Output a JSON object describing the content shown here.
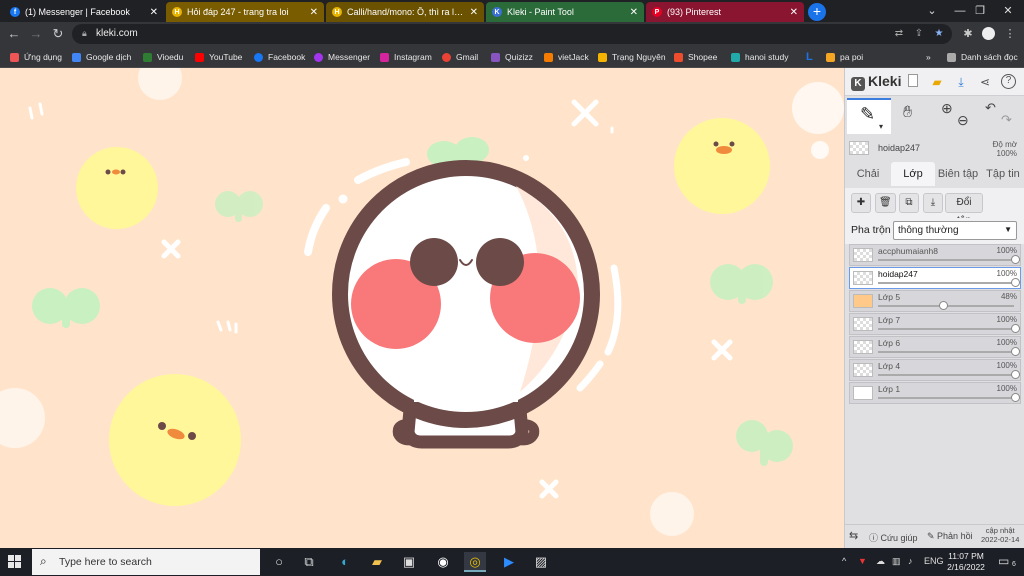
{
  "browser": {
    "tabs": [
      {
        "title": "(1) Messenger | Facebook",
        "icon": "facebook-icon",
        "color": "#1877f2",
        "letter": "f"
      },
      {
        "title": "Hỏi đáp 247 - trang tra loi",
        "icon": "hoidap-icon",
        "color": "#e8b400",
        "letter": "H"
      },
      {
        "title": "Calli/hand/mono: Ồ, thì ra là thế",
        "icon": "hoidap-icon",
        "color": "#e8b400",
        "letter": "H"
      },
      {
        "title": "Kleki - Paint Tool",
        "icon": "kleki-icon",
        "color": "#3a6fd8",
        "letter": "K"
      },
      {
        "title": "(93) Pinterest",
        "icon": "pinterest-icon",
        "color": "#e60023",
        "letter": "P"
      }
    ],
    "url": "kleki.com",
    "bookmarks": [
      {
        "label": "Ứng dụng",
        "color": "#e55"
      },
      {
        "label": "Google dịch",
        "color": "#4285f4"
      },
      {
        "label": "Vioedu",
        "color": "#2e7d32"
      },
      {
        "label": "YouTube",
        "color": "#ff0000"
      },
      {
        "label": "Facebook",
        "color": "#1877f2"
      },
      {
        "label": "Messenger",
        "color": "#a335ee"
      },
      {
        "label": "Instagram",
        "color": "#d6249f"
      },
      {
        "label": "Gmail",
        "color": "#ea4335"
      },
      {
        "label": "Quizizz",
        "color": "#8854c0"
      },
      {
        "label": "vietJack",
        "color": "#f57c00"
      },
      {
        "label": "Trạng Nguyên",
        "color": "#f4b400"
      },
      {
        "label": "Shopee",
        "color": "#ee4d2d"
      },
      {
        "label": "hanoi study",
        "color": "#2aa"
      },
      {
        "label": "L",
        "color": "#1a73e8"
      },
      {
        "label": "pa poi",
        "color": "#f5a623"
      },
      {
        "label": "»",
        "color": "#35363a"
      },
      {
        "label": "Danh sách đọc",
        "color": "#aaa"
      }
    ]
  },
  "kleki": {
    "logo": "Kleki",
    "current_layer": {
      "name": "hoidap247",
      "opacity_label": "Độ mờ",
      "opacity_value": "100%"
    },
    "tabs": [
      "Chải",
      "Lớp",
      "Biên tập",
      "Tập tin"
    ],
    "active_tab": "Lớp",
    "rename_button": "Đổi tên",
    "blend_label": "Pha trộn",
    "blend_value": "thông thường",
    "layers": [
      {
        "name": "accphumaianh8",
        "opacity": "100%",
        "level": 1.0
      },
      {
        "name": "hoidap247",
        "opacity": "100%",
        "level": 1.0,
        "selected": true
      },
      {
        "name": "Lớp 5",
        "opacity": "48%",
        "level": 0.48
      },
      {
        "name": "Lớp 7",
        "opacity": "100%",
        "level": 1.0
      },
      {
        "name": "Lớp 6",
        "opacity": "100%",
        "level": 1.0
      },
      {
        "name": "Lớp 4",
        "opacity": "100%",
        "level": 1.0
      },
      {
        "name": "Lớp 1",
        "opacity": "100%",
        "level": 1.0
      }
    ],
    "bottom": {
      "help": "Cứu giúp",
      "feedback": "Phản hồi",
      "update_line1": "cập nhật",
      "update_line2": "2022-02-14"
    }
  },
  "taskbar": {
    "search_placeholder": "Type here to search",
    "language": "ENG",
    "time": "11:07 PM",
    "date": "2/16/2022",
    "notification_count": "6"
  },
  "colors": {
    "canvas_bg": "#ffe4cb",
    "head_outline": "#6b4a47",
    "blush": "#f9797a",
    "leaf": "#c8f0c0",
    "chick": "#fff79a"
  }
}
